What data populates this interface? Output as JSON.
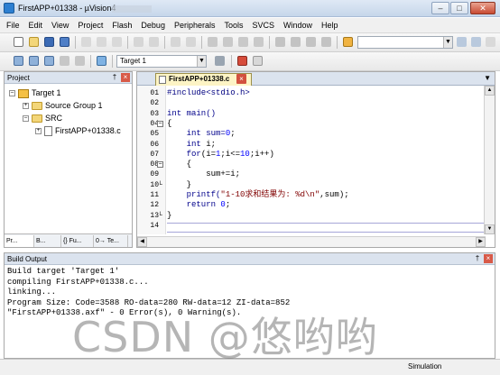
{
  "window": {
    "title": "FirstAPP+01338 - µVision4",
    "min": "–",
    "max": "□",
    "close": "✕"
  },
  "menu": [
    "File",
    "Edit",
    "View",
    "Project",
    "Flash",
    "Debug",
    "Peripherals",
    "Tools",
    "SVCS",
    "Window",
    "Help"
  ],
  "toolbar": {
    "target": "Target 1"
  },
  "project": {
    "title": "Project",
    "pin": "†",
    "close": "×",
    "tree": {
      "target": "Target 1",
      "group": "Source Group 1",
      "src": "SRC",
      "file": "FirstAPP+01338.c",
      "expand_plus": "+",
      "expand_minus": "–"
    },
    "tabs": [
      "Pr...",
      "B...",
      "{} Fu...",
      "0→ Te..."
    ]
  },
  "editor": {
    "tab": "FirstAPP+01338.c",
    "tab_close": "×",
    "menu_arrow": "▼",
    "lines": [
      "01",
      "02",
      "03",
      "04",
      "05",
      "06",
      "07",
      "08",
      "09",
      "10",
      "11",
      "12",
      "13",
      "14"
    ],
    "code": {
      "l1": "#include<stdio.h>",
      "l3": "int main()",
      "l4": "{",
      "l5a": "    int sum=",
      "l5b": "0",
      "l5c": ";",
      "l6a": "    int ",
      "l6b": "i;",
      "l7a": "    for",
      "l7b": "(i=",
      "l7c": "1",
      "l7d": ";i<=",
      "l7e": "10",
      "l7f": ";i++)",
      "l8": "    {",
      "l9": "        sum+=i;",
      "l10": "    }",
      "l11a": "    printf(",
      "l11b": "\"1-10求和结果为: %d\\n\"",
      "l11c": ",sum);",
      "l12a": "    return ",
      "l12b": "0",
      "l12c": ";",
      "l13": "}"
    }
  },
  "output": {
    "title": "Build Output",
    "lines": "Build target 'Target 1'\ncompiling FirstAPP+01338.c...\nlinking...\nProgram Size: Code=3588 RO-data=280 RW-data=12 ZI-data=852\n\"FirstAPP+01338.axf\" - 0 Error(s), 0 Warning(s)."
  },
  "status": "Simulation",
  "watermark": "CSDN @悠哟哟"
}
